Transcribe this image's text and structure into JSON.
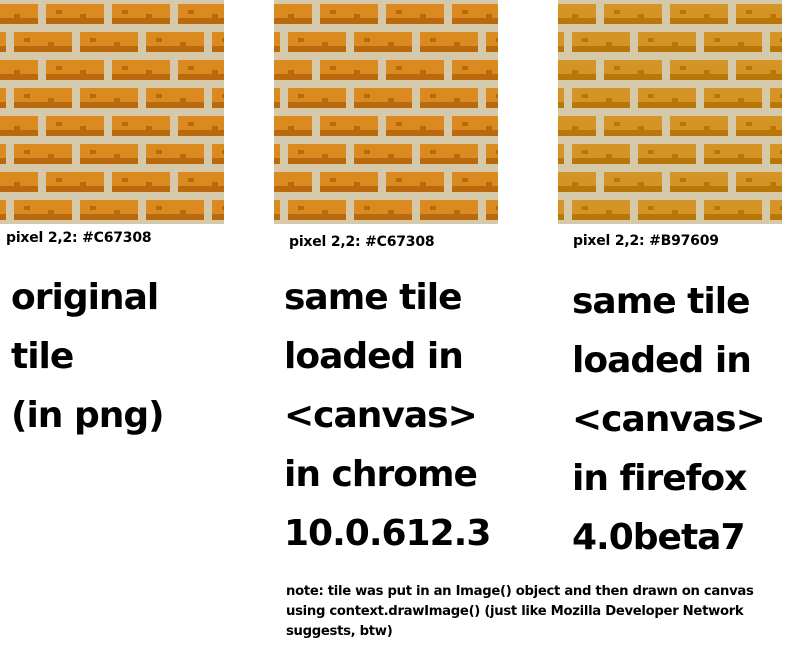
{
  "colors": {
    "brick_light": "#DA8A1E",
    "brick_dark": "#B96A0E",
    "mortar": "#D6C9AA",
    "ff_tint": "#B97609"
  },
  "panels": [
    {
      "pixel_label": "pixel 2,2: #C67308",
      "lines": [
        "original",
        "tile",
        "(in png)"
      ]
    },
    {
      "pixel_label": "pixel 2,2: #C67308",
      "lines": [
        "same tile",
        "loaded in",
        "<canvas>",
        "in chrome",
        "10.0.612.3"
      ]
    },
    {
      "pixel_label": "pixel 2,2: #B97609",
      "lines": [
        "same tile",
        "loaded in",
        "<canvas>",
        "in firefox",
        "4.0beta7"
      ]
    }
  ],
  "note": "note: tile was put in an Image() object and then drawn on canvas using context.drawImage() (just like Mozilla Developer Network suggests, btw)"
}
